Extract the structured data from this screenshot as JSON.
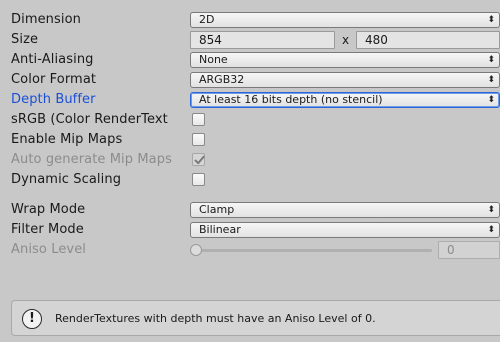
{
  "fields": {
    "dimension": {
      "label": "Dimension",
      "value": "2D"
    },
    "size": {
      "label": "Size",
      "width": "854",
      "separator": "x",
      "height": "480"
    },
    "anti_aliasing": {
      "label": "Anti-Aliasing",
      "value": "None"
    },
    "color_format": {
      "label": "Color Format",
      "value": "ARGB32"
    },
    "depth_buffer": {
      "label": "Depth Buffer",
      "value": "At least 16 bits depth (no stencil)"
    },
    "srgb": {
      "label": "sRGB (Color RenderText",
      "checked": false
    },
    "enable_mip_maps": {
      "label": "Enable Mip Maps",
      "checked": false
    },
    "auto_generate_mip_maps": {
      "label": "Auto generate Mip Maps",
      "checked": true,
      "enabled": false
    },
    "dynamic_scaling": {
      "label": "Dynamic Scaling",
      "checked": false
    },
    "wrap_mode": {
      "label": "Wrap Mode",
      "value": "Clamp"
    },
    "filter_mode": {
      "label": "Filter Mode",
      "value": "Bilinear"
    },
    "aniso_level": {
      "label": "Aniso Level",
      "value": "0",
      "slider_fraction": 0,
      "enabled": false
    }
  },
  "help_box": {
    "icon": "info-icon",
    "message": "RenderTextures with depth must have an Aniso Level of 0."
  },
  "colors": {
    "panel_background": "#c8c8c8",
    "active_label": "#1a4fd6",
    "disabled_text": "#8c8c8c"
  },
  "popup_arrows_glyph": "⬍"
}
